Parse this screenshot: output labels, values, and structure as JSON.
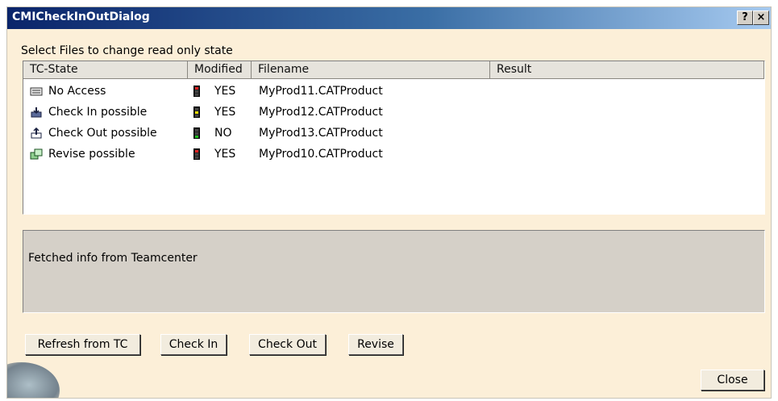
{
  "window": {
    "title": "CMICheckInOutDialog",
    "help_glyph": "?",
    "close_glyph": "×"
  },
  "caption": "Select Files to change read only state",
  "table": {
    "columns": [
      "TC-State",
      "Modified",
      "Filename",
      "Result"
    ],
    "rows": [
      {
        "state": "No Access",
        "state_icon": "no-access-icon",
        "light": "red",
        "modified": "YES",
        "filename": "MyProd11.CATProduct",
        "result": ""
      },
      {
        "state": "Check In possible",
        "state_icon": "check-in-icon",
        "light": "yellow",
        "modified": "YES",
        "filename": "MyProd12.CATProduct",
        "result": ""
      },
      {
        "state": "Check Out possible",
        "state_icon": "check-out-icon",
        "light": "green",
        "modified": "NO",
        "filename": "MyProd13.CATProduct",
        "result": ""
      },
      {
        "state": "Revise possible",
        "state_icon": "revise-icon",
        "light": "red",
        "modified": "YES",
        "filename": "MyProd10.CATProduct",
        "result": ""
      }
    ]
  },
  "status": "Fetched info from Teamcenter",
  "buttons": {
    "refresh": "Refresh from TC",
    "check_in": "Check In",
    "check_out": "Check Out",
    "revise": "Revise",
    "close": "Close"
  },
  "colors": {
    "dialog_bg": "#fcefd8",
    "title_gradient_start": "#0a246a",
    "light_red": "#e02020",
    "light_yellow": "#f0e000",
    "light_green": "#20c020"
  }
}
